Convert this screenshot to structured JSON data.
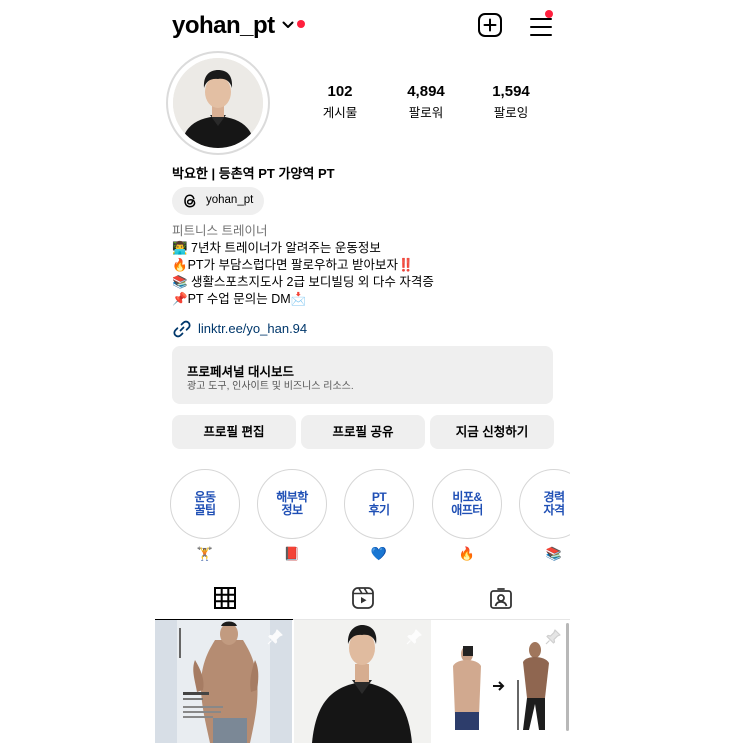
{
  "header": {
    "username": "yohan_pt",
    "icons": [
      "chevron-down-icon",
      "new-post-icon",
      "menu-icon"
    ],
    "notification_color": "#ff1f3d"
  },
  "profile": {
    "stats": [
      {
        "value": "102",
        "label": "게시물"
      },
      {
        "value": "4,894",
        "label": "팔로워"
      },
      {
        "value": "1,594",
        "label": "팔로잉"
      }
    ],
    "full_name": "박요한 | 등촌역 PT 가양역 PT",
    "threads_label": "yohan_pt",
    "category": "피트니스 트레이너",
    "bio_lines": [
      "👨‍💻 7년차 트레이너가 알려주는 운동정보",
      "🔥PT가 부담스럽다면 팔로우하고 받아보자‼️",
      "📚 생활스포츠지도사 2급 보디빌딩 외 다수 자격증",
      "📌PT 수업 문의는 DM📩"
    ],
    "link": "linktr.ee/yo_han.94",
    "link_color": "#00376b"
  },
  "dashboard": {
    "title": "프로페셔널 대시보드",
    "subtitle": "광고 도구, 인사이트 및 비즈니스 리소스."
  },
  "actions": {
    "edit_profile": "프로필 편집",
    "share_profile": "프로필 공유",
    "apply_now": "지금 신청하기"
  },
  "highlights": [
    {
      "title": "운동\n꿀팁",
      "emoji": "🏋️"
    },
    {
      "title": "해부학\n정보",
      "emoji": "📕"
    },
    {
      "title": "PT\n후기",
      "emoji": "💙"
    },
    {
      "title": "비포&\n애프터",
      "emoji": "🔥"
    },
    {
      "title": "경력\n자격",
      "emoji": "📚"
    }
  ],
  "highlight_color": "#1f4fb5",
  "tabs": [
    {
      "name": "grid",
      "icon": "grid-icon",
      "active": true
    },
    {
      "name": "reels",
      "icon": "reels-icon",
      "active": false
    },
    {
      "name": "tagged",
      "icon": "tagged-icon",
      "active": false
    }
  ],
  "posts": [
    {
      "icon": "pin-icon",
      "kind": "poster"
    },
    {
      "icon": "pin-icon",
      "kind": "portrait"
    },
    {
      "icon": "pin-icon",
      "kind": "before-after"
    }
  ]
}
